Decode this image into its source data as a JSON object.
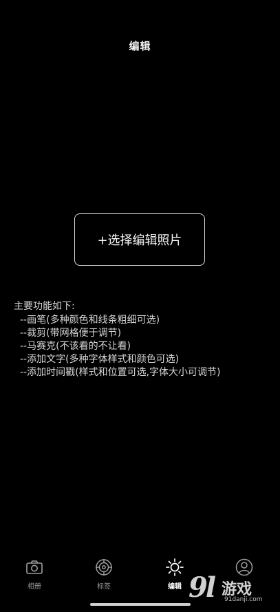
{
  "header": {
    "title": "编辑"
  },
  "main": {
    "select_button_label": "+选择编辑照片",
    "features_heading": "主要功能如下:",
    "features": [
      "--画笔(多种颜色和线条粗细可选)",
      "--裁剪(带网格便于调节)",
      "--马赛克(不该看的不让看)",
      "--添加文字(多种字体样式和颜色可选)",
      "--添加时间戳(样式和位置可选,字体大小可调节)"
    ]
  },
  "tabbar": {
    "active": "编辑",
    "tabs": [
      {
        "label": "相册",
        "icon": "camera-icon"
      },
      {
        "label": "标签",
        "icon": "target-icon"
      },
      {
        "label": "编辑",
        "icon": "sun-icon"
      },
      {
        "label": "",
        "icon": "user-icon"
      }
    ]
  },
  "watermark": {
    "logo": "9l",
    "text": "游戏",
    "url": "91danji.com"
  }
}
